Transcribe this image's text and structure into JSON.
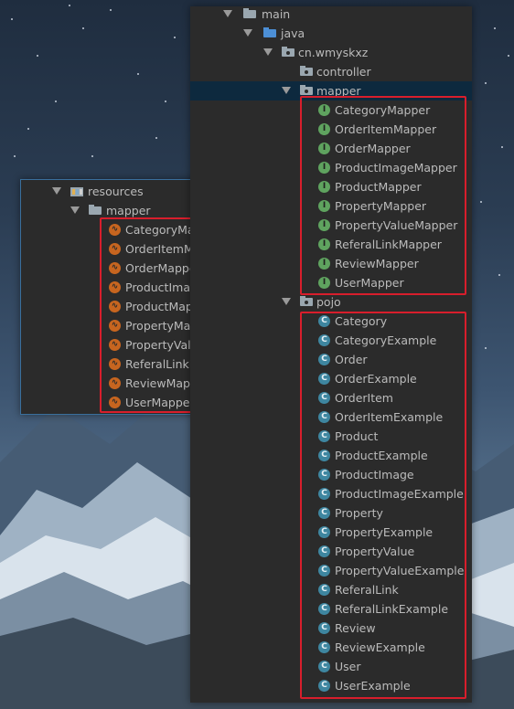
{
  "left_panel": {
    "resources_label": "resources",
    "mapper_label": "mapper",
    "xml_files": [
      "CategoryMapper.xml",
      "OrderItemMapper.xml",
      "OrderMapper.xml",
      "ProductImageMapper.xml",
      "ProductMapper.xml",
      "PropertyMapper.xml",
      "PropertyValueMapper.xml",
      "ReferalLinkMapper.xml",
      "ReviewMapper.xml",
      "UserMapper.xml"
    ]
  },
  "right_panel": {
    "main_label": "main",
    "java_label": "java",
    "package_label": "cn.wmyskxz",
    "controller_label": "controller",
    "mapper_label": "mapper",
    "mapper_icon_letter": "I",
    "mapper_interfaces": [
      "CategoryMapper",
      "OrderItemMapper",
      "OrderMapper",
      "ProductImageMapper",
      "ProductMapper",
      "PropertyMapper",
      "PropertyValueMapper",
      "ReferalLinkMapper",
      "ReviewMapper",
      "UserMapper"
    ],
    "pojo_label": "pojo",
    "pojo_icon_letter": "C",
    "pojo_classes": [
      "Category",
      "CategoryExample",
      "Order",
      "OrderExample",
      "OrderItem",
      "OrderItemExample",
      "Product",
      "ProductExample",
      "ProductImage",
      "ProductImageExample",
      "Property",
      "PropertyExample",
      "PropertyValue",
      "PropertyValueExample",
      "ReferalLink",
      "ReferalLinkExample",
      "Review",
      "ReviewExample",
      "User",
      "UserExample"
    ]
  },
  "colors": {
    "panel_bg": "#2b2b2b",
    "text": "#bbbbbb",
    "selection": "#0d293e",
    "highlight_box": "#d81e2c",
    "interface_icon": "#5fa35f",
    "class_icon": "#3e86a0",
    "xml_icon": "#c7651f",
    "java_folder": "#4c8fd6"
  },
  "icons": {
    "expand": "chevron-down-icon",
    "folder": "folder-icon",
    "source_folder": "source-folder-icon",
    "package": "package-icon",
    "resources": "resources-folder-icon",
    "interface": "interface-icon",
    "class": "class-icon",
    "xml": "mybatis-xml-icon"
  }
}
